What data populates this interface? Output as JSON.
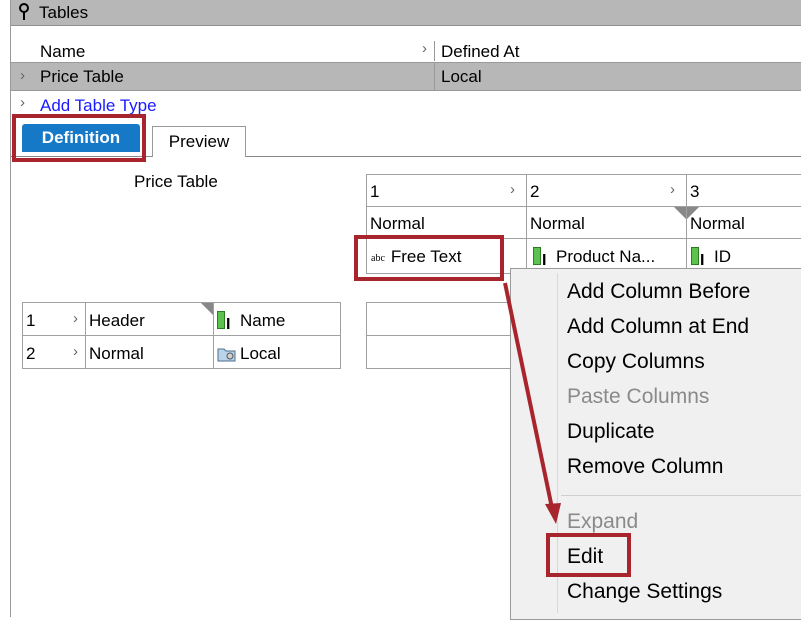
{
  "panel": {
    "title": "Tables",
    "columns": {
      "name": "Name",
      "defined_at": "Defined At"
    },
    "rows": [
      {
        "name": "Price Table",
        "defined_at": "Local"
      }
    ],
    "add_link": "Add Table Type"
  },
  "tabs": [
    {
      "label": "Definition"
    },
    {
      "label": "Preview"
    }
  ],
  "grid": {
    "table_label": "Price Table",
    "columns": [
      {
        "num": "1",
        "type": "Normal",
        "content": "Free Text"
      },
      {
        "num": "2",
        "type": "Normal",
        "content": "Product Na..."
      },
      {
        "num": "3",
        "type": "Normal",
        "content": "ID"
      }
    ],
    "rows": [
      {
        "num": "1",
        "type": "Header",
        "value": "Name"
      },
      {
        "num": "2",
        "type": "Normal",
        "value": "Local"
      }
    ]
  },
  "context_menu": {
    "items": [
      {
        "label": "Add Column Before",
        "enabled": true
      },
      {
        "label": "Add Column at End",
        "enabled": true
      },
      {
        "label": "Copy Columns",
        "enabled": true
      },
      {
        "label": "Paste Columns",
        "enabled": false
      },
      {
        "label": "Duplicate",
        "enabled": true
      },
      {
        "label": "Remove Column",
        "enabled": true
      },
      {
        "label": "Expand",
        "enabled": false
      },
      {
        "label": "Edit",
        "enabled": true
      },
      {
        "label": "Change Settings",
        "enabled": true
      }
    ]
  },
  "colors": {
    "highlight": "#a8252e",
    "tab_active": "#1679c7",
    "link": "#1a1aff"
  }
}
